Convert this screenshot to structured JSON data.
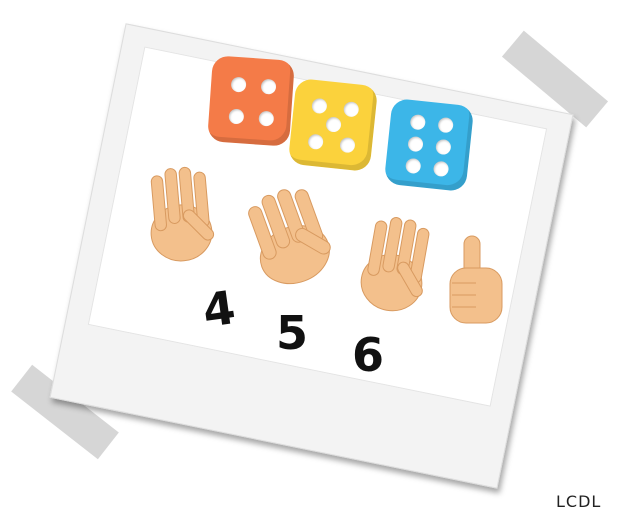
{
  "dice": [
    {
      "pips": 4,
      "color": "#f47b48"
    },
    {
      "pips": 5,
      "color": "#fbd23c"
    },
    {
      "pips": 6,
      "color": "#3cb6e8"
    }
  ],
  "hands": [
    {
      "fingers": 5
    },
    {
      "fingers": 5
    },
    {
      "fingers": 5
    },
    {
      "fingers": 1
    }
  ],
  "numbers": [
    "4",
    "5",
    "6"
  ],
  "credit": "LCDL"
}
